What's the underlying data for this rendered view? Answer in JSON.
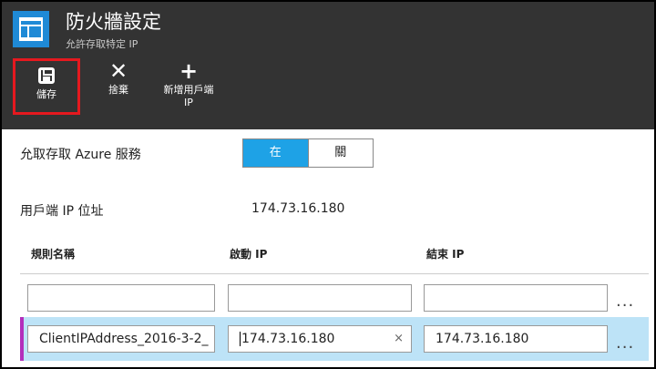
{
  "header": {
    "title": "防火牆設定",
    "subtitle": "允許存取特定 IP",
    "icon": "firewall-blade-icon"
  },
  "toolbar": {
    "save_label": "儲存",
    "discard_label": "捨棄",
    "add_label_line1": "新增用戶端",
    "add_label_line2": "IP",
    "save_icon": "floppy-disk-icon",
    "discard_icon": "x-icon",
    "add_icon": "plus-icon"
  },
  "azure_access": {
    "label": "允取存取 Azure 服務",
    "on_label": "在",
    "off_label": "關",
    "selected": "在"
  },
  "client_ip": {
    "label": "用戶端 IP 位址",
    "value": "174.73.16.180"
  },
  "rules_table": {
    "columns": [
      "規則名稱",
      "啟動 IP",
      "結束 IP"
    ],
    "rows": [
      {
        "rule_name": "",
        "start_ip": "",
        "end_ip": "",
        "more": "..."
      },
      {
        "rule_name": "ClientIPAddress_2016-3-2_",
        "start_ip": "174.73.16.180",
        "end_ip": "174.73.16.180",
        "more": "...",
        "clear": "×"
      }
    ]
  },
  "colors": {
    "header_bg": "#333333",
    "accent_blue": "#1ea2e6",
    "highlight_row": "#bde3f7",
    "row_marker": "#b32fbb",
    "save_outline": "#e5191f"
  }
}
